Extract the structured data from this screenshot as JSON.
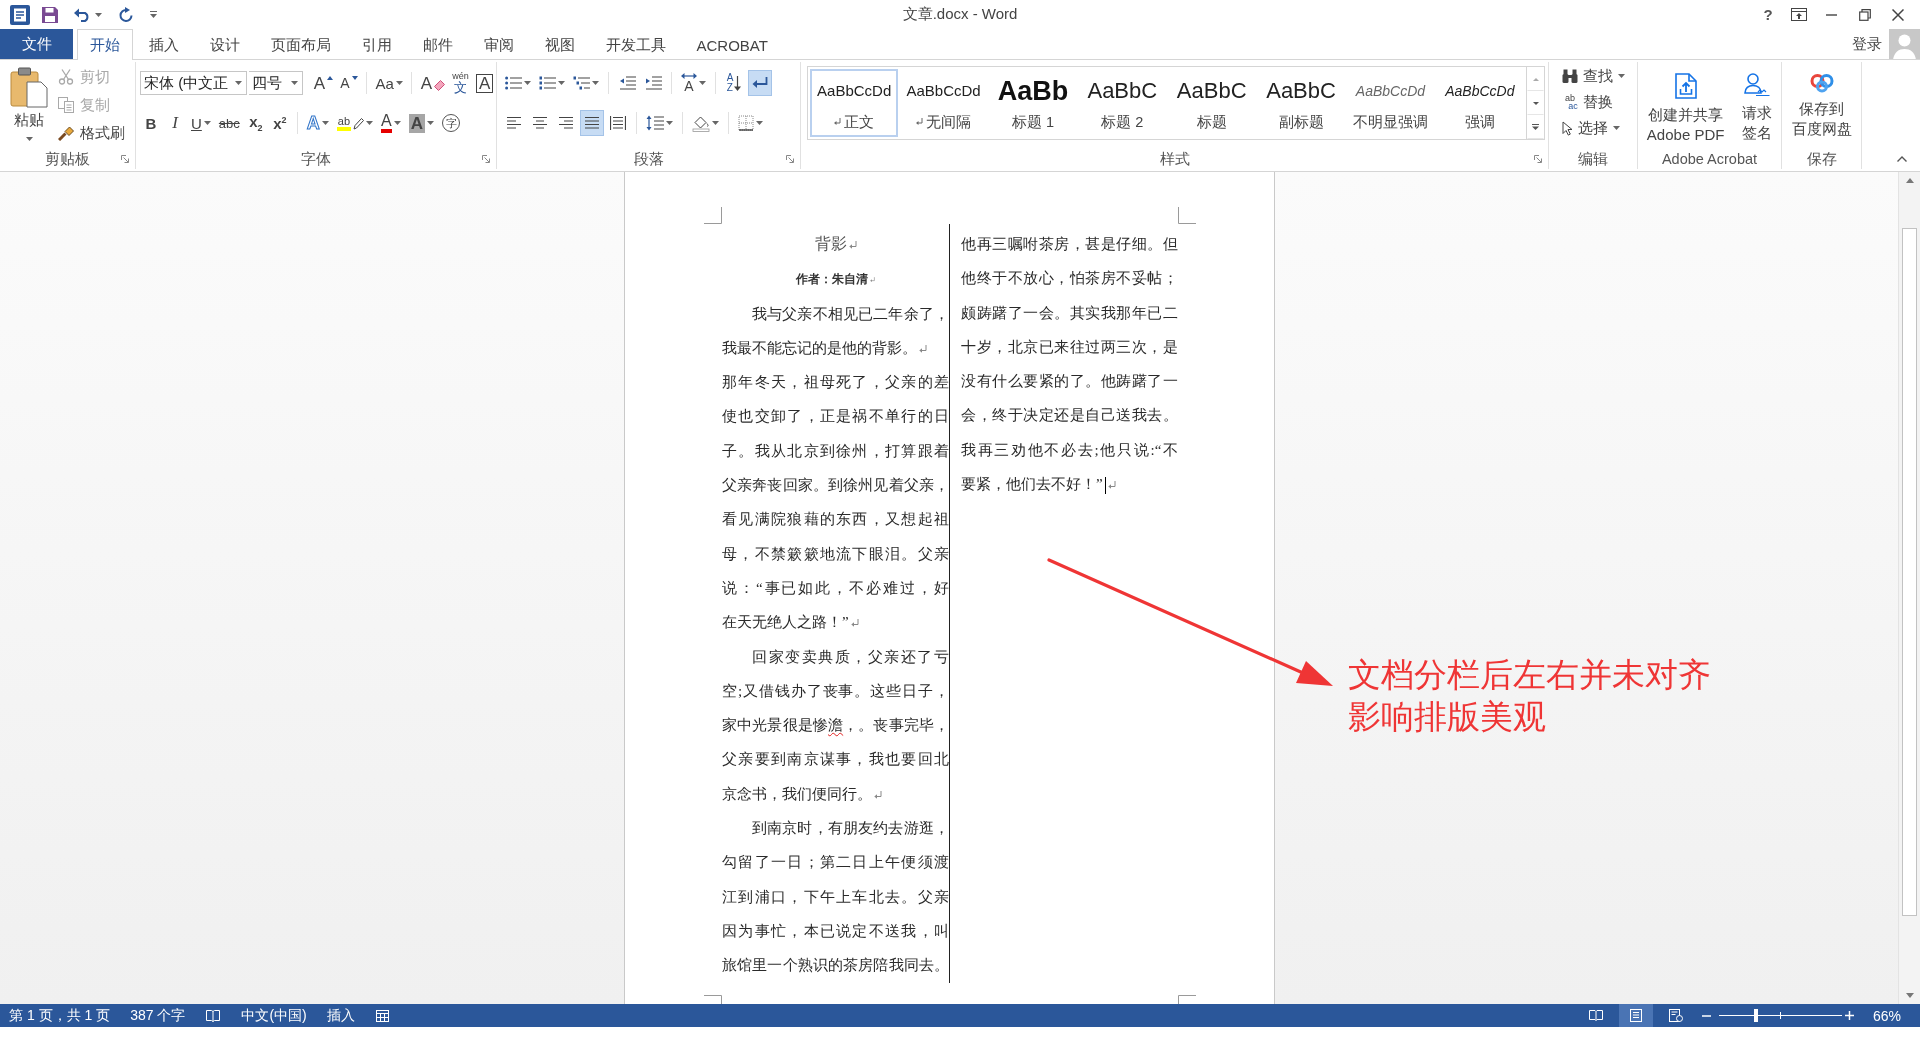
{
  "title_bar": {
    "title": "文章.docx - Word",
    "help": "?"
  },
  "file_tab": "文件",
  "tabs": [
    {
      "label": "开始",
      "selected": true
    },
    {
      "label": "插入",
      "selected": false
    },
    {
      "label": "设计",
      "selected": false
    },
    {
      "label": "页面布局",
      "selected": false
    },
    {
      "label": "引用",
      "selected": false
    },
    {
      "label": "邮件",
      "selected": false
    },
    {
      "label": "审阅",
      "selected": false
    },
    {
      "label": "视图",
      "selected": false
    },
    {
      "label": "开发工具",
      "selected": false
    },
    {
      "label": "ACROBAT",
      "selected": false
    }
  ],
  "account": {
    "sign_in": "登录"
  },
  "ribbon": {
    "clipboard": {
      "label": "剪贴板",
      "paste": "粘贴",
      "items": [
        {
          "kind": "cut",
          "label": "剪切",
          "disabled": true
        },
        {
          "kind": "copy",
          "label": "复制",
          "disabled": true
        },
        {
          "kind": "painter",
          "label": "格式刷",
          "disabled": false
        }
      ]
    },
    "font": {
      "label": "字体",
      "font_name": "宋体 (中文正",
      "font_size": "四号",
      "row1": [
        {
          "kind": "grow",
          "glyph": "A"
        },
        {
          "kind": "shrink",
          "glyph": "A"
        },
        {
          "kind": "case",
          "glyph": "Aa"
        },
        {
          "kind": "clear",
          "glyph": "A"
        },
        {
          "kind": "phonetic",
          "glyph": "wén",
          "sub": "文"
        },
        {
          "kind": "border",
          "glyph": "A"
        }
      ],
      "row2": [
        {
          "kind": "bold",
          "glyph": "B"
        },
        {
          "kind": "italic",
          "glyph": "I"
        },
        {
          "kind": "underline",
          "glyph": "U"
        },
        {
          "kind": "strike",
          "glyph": "abc"
        },
        {
          "kind": "subscript",
          "glyph": "x$_{2}$"
        },
        {
          "kind": "superscript",
          "glyph": "x$^{2}$"
        },
        {
          "kind": "effects",
          "glyph": "A"
        },
        {
          "kind": "highlight",
          "glyph": "ab"
        },
        {
          "kind": "color",
          "glyph": "A"
        },
        {
          "kind": "shading",
          "glyph": "A"
        },
        {
          "kind": "enclose",
          "glyph": "字"
        }
      ]
    },
    "paragraph": {
      "label": "段落",
      "row1": [
        {
          "kind": "bullets"
        },
        {
          "kind": "numbering"
        },
        {
          "kind": "multilevel"
        },
        {
          "kind": "outdent"
        },
        {
          "kind": "indent"
        },
        {
          "kind": "asian",
          "glyph": "A"
        },
        {
          "kind": "sort",
          "glyph": "AZ"
        },
        {
          "kind": "marks",
          "on": true
        }
      ],
      "align": [
        {
          "kind": "left",
          "selected": false
        },
        {
          "kind": "center",
          "selected": false
        },
        {
          "kind": "right",
          "selected": false
        },
        {
          "kind": "justify",
          "selected": true
        },
        {
          "kind": "distributed",
          "selected": false
        }
      ],
      "row2": [
        {
          "kind": "spacing"
        },
        {
          "kind": "shading"
        },
        {
          "kind": "borders"
        }
      ]
    },
    "styles": {
      "label": "样式",
      "items": [
        {
          "kind": "normal",
          "sample": "AaBbCcDd",
          "label": "正文",
          "mark": true,
          "selected": true
        },
        {
          "kind": "normal",
          "sample": "AaBbCcDd",
          "label": "无间隔",
          "mark": true,
          "selected": false
        },
        {
          "kind": "h1",
          "sample": "AaBb",
          "label": "标题 1",
          "mark": false,
          "selected": false
        },
        {
          "kind": "h2",
          "sample": "AaBbC",
          "label": "标题 2",
          "mark": false,
          "selected": false
        },
        {
          "kind": "title",
          "sample": "AaBbC",
          "label": "标题",
          "mark": false,
          "selected": false
        },
        {
          "kind": "subtitle",
          "sample": "AaBbC",
          "label": "副标题",
          "mark": false,
          "selected": false
        },
        {
          "kind": "subtle",
          "sample": "AaBbCcDd",
          "label": "不明显强调",
          "mark": false,
          "selected": false
        },
        {
          "kind": "emphasis",
          "sample": "AaBbCcDd",
          "label": "强调",
          "mark": false,
          "selected": false
        }
      ]
    },
    "editing": {
      "label": "编辑",
      "items": [
        {
          "kind": "find",
          "label": "查找"
        },
        {
          "kind": "replace",
          "label": "替换",
          "glyph": "ab",
          "glyph2": "ac"
        },
        {
          "kind": "select",
          "label": "选择"
        }
      ]
    },
    "acrobat": {
      "label": "Adobe Acrobat",
      "buttons": [
        {
          "kind": "create",
          "lines": [
            "创建并共享",
            "Adobe PDF"
          ]
        },
        {
          "kind": "sign",
          "lines": [
            "请求",
            "签名"
          ]
        }
      ]
    },
    "save": {
      "label": "保存",
      "buttons": [
        {
          "kind": "cloud",
          "lines": [
            "保存到",
            "百度网盘"
          ]
        }
      ]
    }
  },
  "document": {
    "columns": [
      {
        "paragraphs": [
          {
            "kind": "title",
            "indent": false,
            "lines": [
              "背影"
            ],
            "mark": true
          },
          {
            "kind": "author",
            "indent": false,
            "lines": [
              "作者：朱自清"
            ],
            "mark": true
          },
          {
            "kind": "body",
            "indent": true,
            "lines": [
              "我与父亲不相见已二年余了，",
              "我最不能忘记的是他的背影。"
            ],
            "mark": true
          },
          {
            "kind": "body",
            "indent": false,
            "lines": [
              "那年冬天，祖母死了，父亲的差",
              "使也交卸了，正是祸不单行的日",
              "子。我从北京到徐州，打算跟着",
              "父亲奔丧回家。到徐州见着父亲，",
              "看见满院狼藉的东西，又想起祖",
              "母，不禁簌簌地流下眼泪。父亲",
              "说：“事已如此，不必难过，好",
              "在天无绝人之路！”"
            ],
            "mark": true
          },
          {
            "kind": "body",
            "indent": true,
            "lines": [
              "回家变卖典质，父亲还了亏",
              "空;又借钱办了丧事。这些日子，",
              [
                {
                  "text": "家中光景很是惨",
                  "spelling_error": false
                },
                {
                  "text": "澹",
                  "spelling_error": true
                },
                {
                  "text": "，。丧事完毕，",
                  "spelling_error": false
                }
              ],
              "父亲要到南京谋事，我也要回北",
              "京念书，我们便同行。"
            ],
            "mark": true
          },
          {
            "kind": "body",
            "indent": true,
            "lines": [
              "到南京时，有朋友约去游逛，",
              "勾留了一日；第二日上午便须渡",
              "江到浦口，下午上车北去。父亲",
              "因为事忙，本已说定不送我，叫",
              "旅馆里一个熟识的茶房陪我同去。"
            ],
            "mark": false
          }
        ]
      },
      {
        "paragraphs": [
          {
            "kind": "body",
            "indent": false,
            "lines": [
              "他再三嘱咐茶房，甚是仔细。但",
              "他终于不放心，怕茶房不妥帖；",
              "颇踌躇了一会。其实我那年已二",
              "十岁，北京已来往过两三次，是",
              "没有什么要紧的了。他踌躇了一",
              "会，终于决定还是自己送我去。",
              "我再三劝他不必去;他只说:“不",
              "要紧，他们去不好！”"
            ],
            "mark": true,
            "cursor": true
          }
        ]
      }
    ]
  },
  "annotation": {
    "lines": [
      "文档分栏后左右并未对齐",
      "影响排版美观"
    ]
  },
  "status_bar": {
    "page": "第 1 页，共 1 页",
    "words": "387 个字",
    "language": "中文(中国)",
    "mode": "插入",
    "views": [
      {
        "kind": "read",
        "selected": false
      },
      {
        "kind": "print",
        "selected": true
      },
      {
        "kind": "web",
        "selected": false
      }
    ],
    "zoom": {
      "level": 0.3,
      "label": "66%"
    }
  }
}
